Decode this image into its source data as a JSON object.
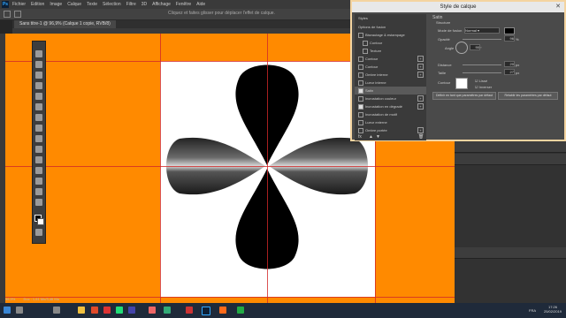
{
  "app": {
    "logo": "Ps",
    "menu": [
      "Fichier",
      "Edition",
      "Image",
      "Calque",
      "Texte",
      "Sélection",
      "Filtre",
      "3D",
      "Affichage",
      "Fenêtre",
      "Aide"
    ],
    "options_hint": "Cliquez et faites glisser pour déplacer l'effet de calque."
  },
  "document": {
    "tab_title": "Sans titre-1 @ 96,9% (Calque 1 copie, RVB/8)",
    "zoom": "96,9%",
    "doc_info": "Doc : 1,61 Mo/3,46 Mo"
  },
  "dialog": {
    "title": "Style de calque",
    "styles_header": "Styles",
    "items": [
      {
        "label": "Options de fusion",
        "check": null,
        "plus": false,
        "selected": false
      },
      {
        "label": "Biseautage & estampage",
        "check": false,
        "plus": false,
        "selected": false
      },
      {
        "label": "Contour",
        "check": false,
        "plus": false,
        "selected": false,
        "indent": true
      },
      {
        "label": "Texture",
        "check": false,
        "plus": false,
        "selected": false,
        "indent": true
      },
      {
        "label": "Contour",
        "check": false,
        "plus": true,
        "selected": false
      },
      {
        "label": "Contour",
        "check": false,
        "plus": true,
        "selected": false
      },
      {
        "label": "Ombre interne",
        "check": false,
        "plus": true,
        "selected": false
      },
      {
        "label": "Lueur interne",
        "check": false,
        "plus": false,
        "selected": false
      },
      {
        "label": "Satin",
        "check": true,
        "plus": false,
        "selected": true
      },
      {
        "label": "Incrustation couleur",
        "check": false,
        "plus": true,
        "selected": false
      },
      {
        "label": "Incrustation en dégradé",
        "check": true,
        "plus": true,
        "selected": false
      },
      {
        "label": "Incrustation de motif",
        "check": false,
        "plus": false,
        "selected": false
      },
      {
        "label": "Lueur externe",
        "check": false,
        "plus": false,
        "selected": false
      },
      {
        "label": "Ombre portée",
        "check": false,
        "plus": true,
        "selected": false
      }
    ],
    "section": "Satin",
    "structure": "Structure",
    "blend_label": "Mode de fusion",
    "blend_value": "Normal",
    "opacity_label": "Opacité",
    "opacity_value": "96",
    "angle_label": "Angle",
    "angle_value": "90",
    "distance_label": "Distance",
    "distance_value": "20",
    "size_label": "Taille",
    "size_value": "27",
    "contour_label": "Contour",
    "lissage_label": "Lissé",
    "inverse_label": "Inverser",
    "default_btn": "Définir en tant que paramètres par défaut",
    "reset_btn": "Rétablir les paramètres par défaut",
    "fx_icon": "fx-icon",
    "accent": "#ff8a00",
    "swatch_color": "#000000"
  },
  "taskbar": {
    "time": "17:26",
    "date": "25/02/2019",
    "lang": "FRA"
  }
}
